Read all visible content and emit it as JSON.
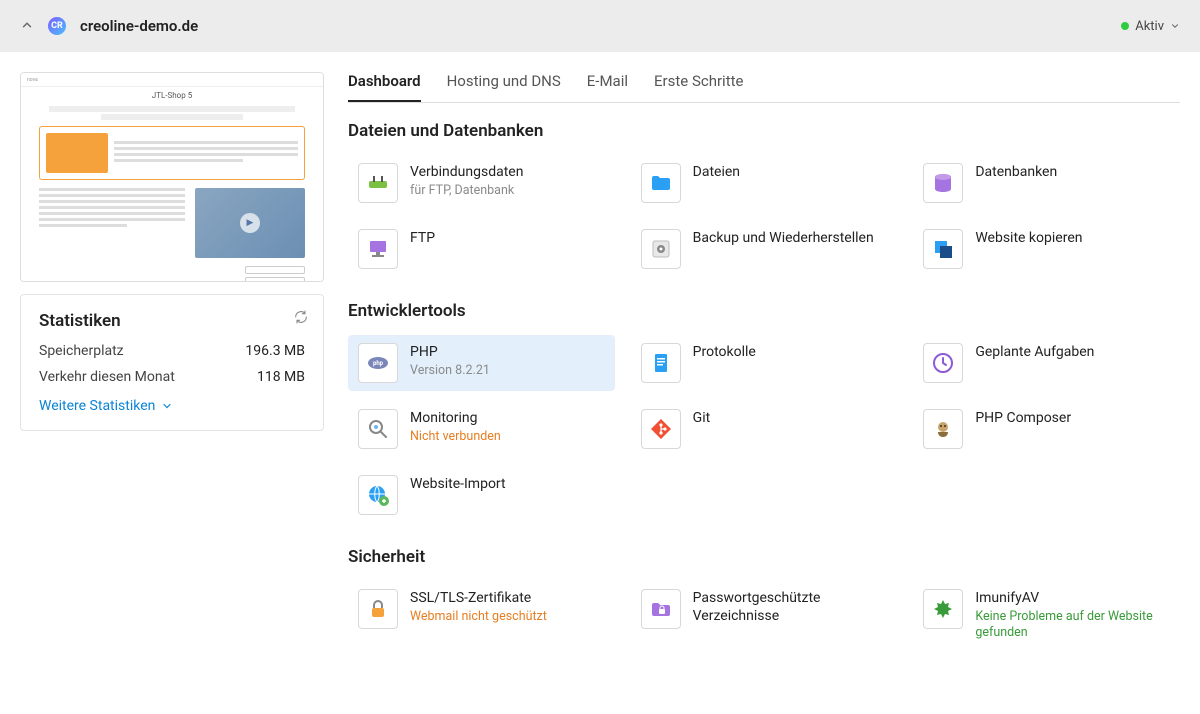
{
  "topbar": {
    "favicon_text": "CR",
    "domain": "creoline-demo.de",
    "status_label": "Aktiv"
  },
  "stats": {
    "heading": "Statistiken",
    "disk_label": "Speicherplatz",
    "disk_value": "196.3 MB",
    "traffic_label": "Verkehr diesen Monat",
    "traffic_value": "118 MB",
    "more_label": "Weitere Statistiken"
  },
  "tabs": {
    "dashboard": "Dashboard",
    "hosting": "Hosting und DNS",
    "email": "E-Mail",
    "firststeps": "Erste Schritte"
  },
  "sections": {
    "files_db": "Dateien und Datenbanken",
    "devtools": "Entwicklertools",
    "security": "Sicherheit"
  },
  "tiles": {
    "conn": {
      "title": "Verbindungsdaten",
      "sub": "für FTP, Datenbank"
    },
    "files": {
      "title": "Dateien"
    },
    "db": {
      "title": "Datenbanken"
    },
    "ftp": {
      "title": "FTP"
    },
    "backup": {
      "title": "Backup und Wiederherstellen"
    },
    "copy": {
      "title": "Website kopieren"
    },
    "php": {
      "title": "PHP",
      "sub": "Version 8.2.21"
    },
    "logs": {
      "title": "Protokolle"
    },
    "cron": {
      "title": "Geplante Aufgaben"
    },
    "monitoring": {
      "title": "Monitoring",
      "warn": "Nicht verbunden"
    },
    "git": {
      "title": "Git"
    },
    "composer": {
      "title": "PHP Composer"
    },
    "import": {
      "title": "Website-Import"
    },
    "ssl": {
      "title": "SSL/TLS-Zertifikate",
      "warn": "Webmail nicht geschützt"
    },
    "pwdirs": {
      "title": "Passwortgeschützte Verzeichnisse"
    },
    "imunify": {
      "title": "ImunifyAV",
      "ok": "Keine Probleme auf der Website gefunden"
    }
  }
}
